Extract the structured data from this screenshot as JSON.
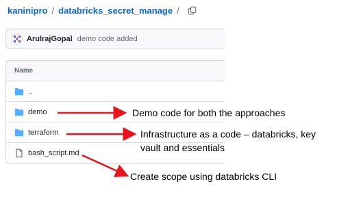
{
  "breadcrumb": {
    "owner": "kaninipro",
    "separator": "/",
    "repo": "databricks_secret_manage",
    "trailing_separator": "/",
    "copy_icon": "copy-icon"
  },
  "commit": {
    "avatar_icon": "avatar-identicon",
    "author": "ArulrajGopal",
    "message": "demo code added"
  },
  "file_table": {
    "header": "Name",
    "rows": [
      {
        "name": "..",
        "icon": "folder-icon"
      },
      {
        "name": "demo",
        "icon": "folder-icon"
      },
      {
        "name": "terraform",
        "icon": "folder-icon"
      },
      {
        "name": "bash_script.md",
        "icon": "file-icon"
      }
    ]
  },
  "annotations": {
    "demo": "Demo code for both the approaches",
    "terraform_line1": "Infrastructure as a code – databricks, key",
    "terraform_line2": "vault and essentials",
    "bash": "Create scope using databricks CLI",
    "arrow_color": "#e8141b"
  },
  "colors": {
    "link": "#0969da",
    "folder": "#54aeff",
    "muted": "#656d76",
    "border": "#d0d7de",
    "avatar": "#7a46c9"
  }
}
